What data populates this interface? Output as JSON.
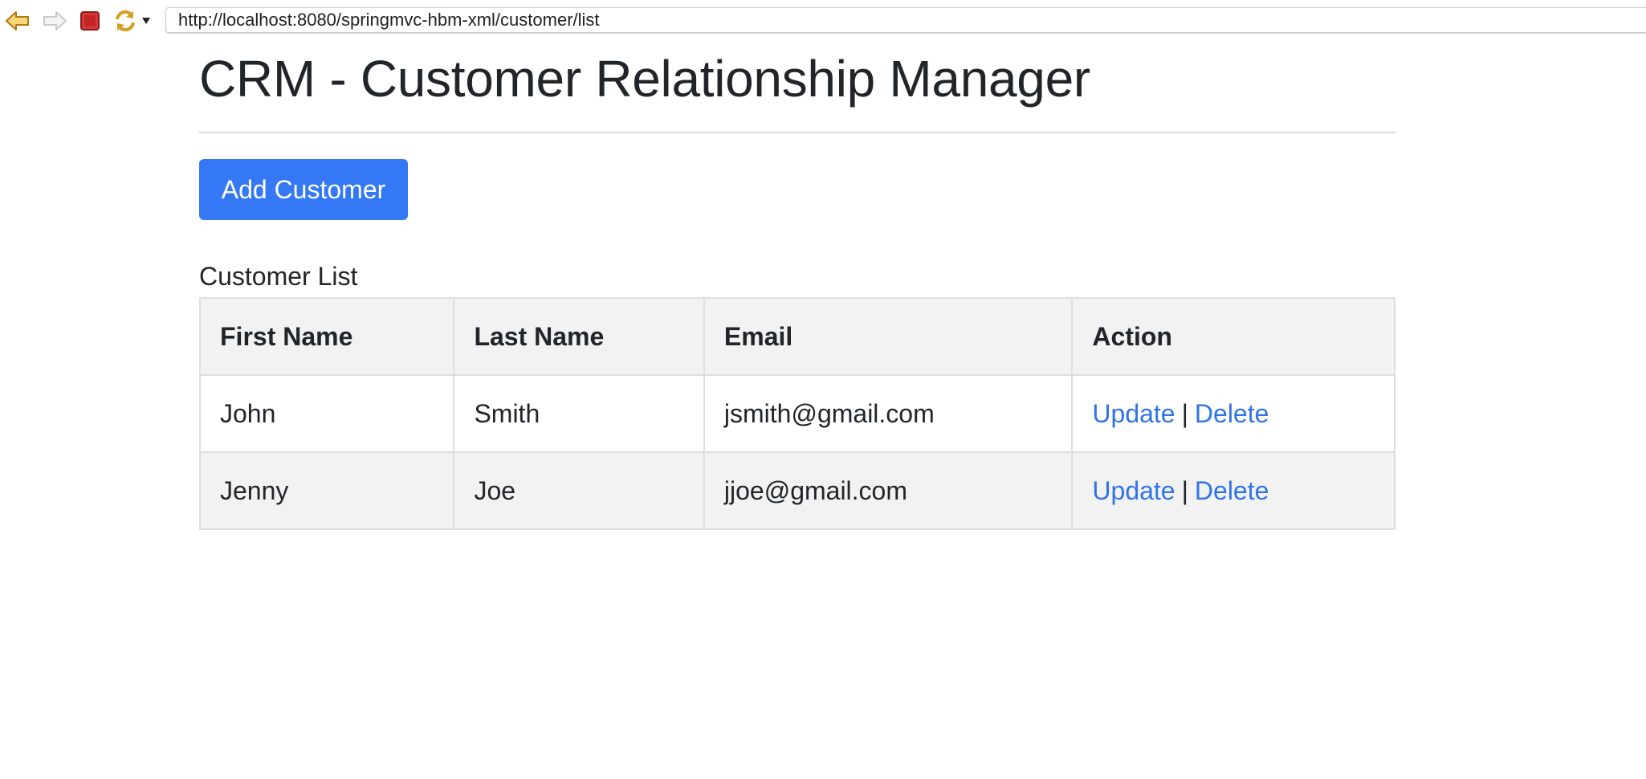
{
  "browser": {
    "url": "http://localhost:8080/springmvc-hbm-xml/customer/list",
    "icons": [
      "back-arrow-icon",
      "forward-arrow-icon",
      "stop-icon",
      "refresh-icon",
      "dropdown-arrow-icon"
    ]
  },
  "page": {
    "title": "CRM - Customer Relationship Manager",
    "add_button_label": "Add Customer",
    "list_caption": "Customer List"
  },
  "table": {
    "headers": [
      "First Name",
      "Last Name",
      "Email",
      "Action"
    ],
    "rows": [
      {
        "first_name": "John",
        "last_name": "Smith",
        "email": "jsmith@gmail.com",
        "update_label": "Update",
        "separator": "|",
        "delete_label": "Delete"
      },
      {
        "first_name": "Jenny",
        "last_name": "Joe",
        "email": "jjoe@gmail.com",
        "update_label": "Update",
        "separator": "|",
        "delete_label": "Delete"
      }
    ]
  },
  "colors": {
    "primary": "#3478f6",
    "link": "#2f74e6",
    "header_bg": "#f2f2f2",
    "text": "#212529"
  }
}
